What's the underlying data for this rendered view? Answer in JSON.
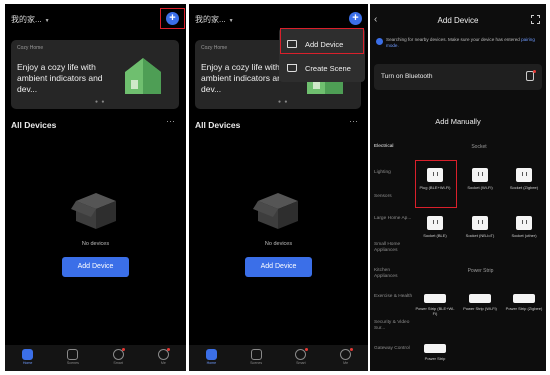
{
  "screens": [
    {
      "home_name": "我的家...",
      "banner": {
        "home_label": "Cozy Home",
        "text": "Enjoy a cozy life with ambient indicators and dev...",
        "dots": "● ●"
      },
      "section": "All Devices",
      "more": "···",
      "empty_text": "No devices",
      "add_device": "Add Device",
      "add_symbol": "+"
    },
    {
      "home_name": "我的家...",
      "banner": {
        "home_label": "Cozy Home",
        "text": "Enjoy a cozy life with ambient indicators and dev...",
        "dots": "● ●"
      },
      "section": "All Devices",
      "more": "···",
      "empty_text": "No devices",
      "add_device": "Add Device",
      "add_symbol": "+",
      "menu": [
        {
          "label": "Add Device"
        },
        {
          "label": "Create Scene"
        }
      ]
    }
  ],
  "tabs": [
    "Home",
    "Scenes",
    "Smart",
    "Me"
  ],
  "add_device_screen": {
    "title": "Add Device",
    "back": "‹",
    "search_text": "Searching for nearby devices. Make sure your device has entered ",
    "search_link": "pairing mode.",
    "bluetooth": "Turn on Bluetooth",
    "add_manually": "Add Manually",
    "categories": [
      "Electrical",
      "Lighting",
      "Sensors",
      "Large Home Ap...",
      "Small Home Appliances",
      "Kitchen Appliances",
      "Exercise & Health",
      "Security & Video Sur...",
      "Gateway Control"
    ],
    "groups": {
      "socket": "Socket",
      "power_strip": "Power Strip"
    },
    "socket_tiles": [
      {
        "name": "Plug (BLE+Wi-Fi)"
      },
      {
        "name": "Socket (Wi-Fi)"
      },
      {
        "name": "Socket (Zigbee)"
      },
      {
        "name": "Socket (BLE)"
      },
      {
        "name": "Socket (NB-IoT)"
      },
      {
        "name": "Socket (other)"
      }
    ],
    "strip_tiles": [
      {
        "name": "Power Strip (BLE+Wi-Fi)"
      },
      {
        "name": "Power Strip (Wi-Fi)"
      },
      {
        "name": "Power Strip (Zigbee)"
      },
      {
        "name": "Power Strip"
      }
    ]
  },
  "colors": {
    "accent": "#3b6fe8",
    "highlight": "#d9202b",
    "background": "#000000"
  }
}
